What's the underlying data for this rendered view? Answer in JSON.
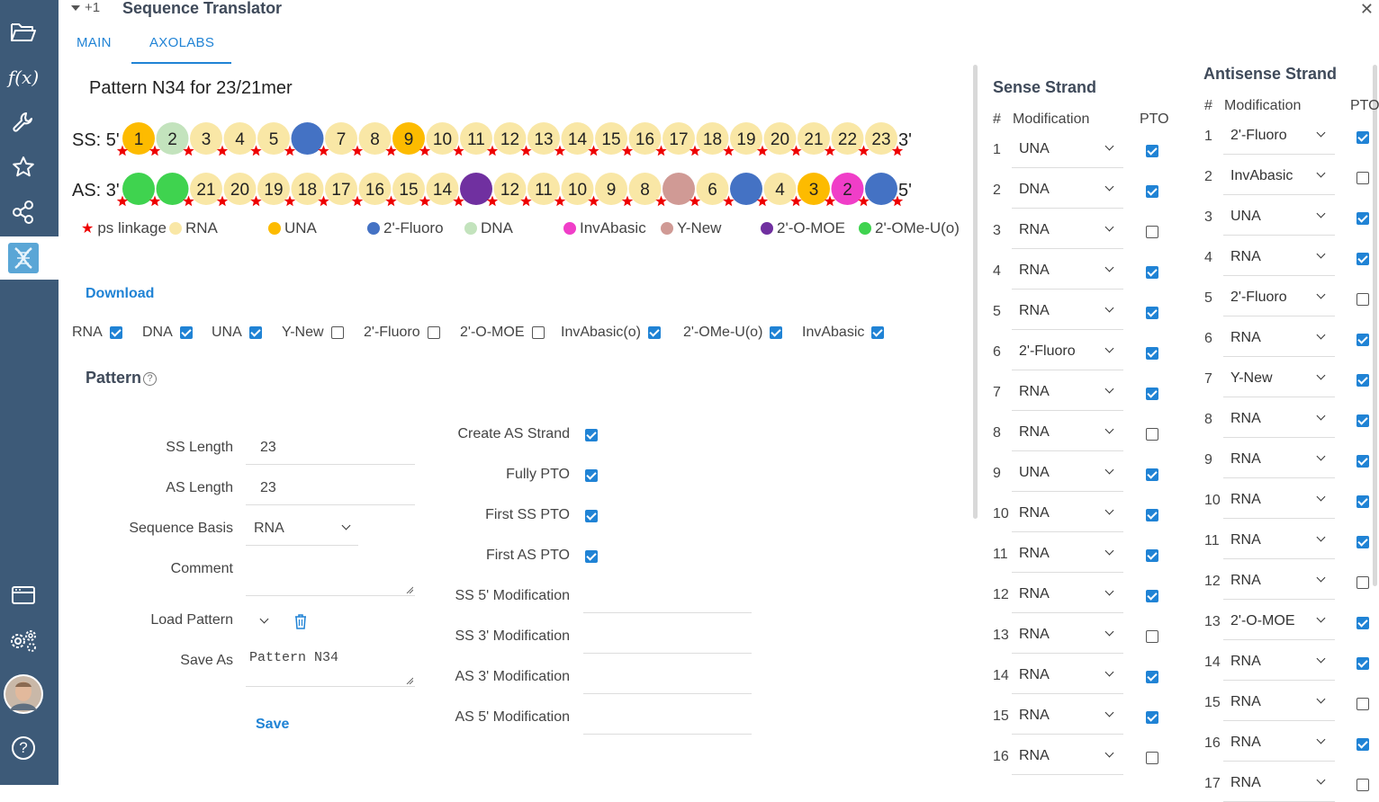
{
  "app": {
    "title": "Sequence Translator",
    "plus_label": "+1",
    "close_glyph": "✕"
  },
  "tabs": [
    {
      "label": "MAIN",
      "active": false
    },
    {
      "label": "AXOLABS",
      "active": true
    }
  ],
  "pattern_title": "Pattern N34 for 23/21mer",
  "pattern_view": {
    "ss_label": "SS: 5'",
    "ss_end": "3'",
    "as_label": "AS: 3'",
    "as_end": "5'",
    "ss": [
      {
        "t": "1",
        "c": "#fdbb00"
      },
      {
        "t": "2",
        "c": "#c3e3bd"
      },
      {
        "t": "3",
        "c": "#f9e7a6"
      },
      {
        "t": "4",
        "c": "#f9e7a6"
      },
      {
        "t": "5",
        "c": "#f9e7a6"
      },
      {
        "t": "",
        "c": "#4472c4"
      },
      {
        "t": "7",
        "c": "#f9e7a6"
      },
      {
        "t": "8",
        "c": "#f9e7a6"
      },
      {
        "t": "9",
        "c": "#fdbb00"
      },
      {
        "t": "10",
        "c": "#f9e7a6"
      },
      {
        "t": "11",
        "c": "#f9e7a6"
      },
      {
        "t": "12",
        "c": "#f9e7a6"
      },
      {
        "t": "13",
        "c": "#f9e7a6"
      },
      {
        "t": "14",
        "c": "#f9e7a6"
      },
      {
        "t": "15",
        "c": "#f9e7a6"
      },
      {
        "t": "16",
        "c": "#f9e7a6"
      },
      {
        "t": "17",
        "c": "#f9e7a6"
      },
      {
        "t": "18",
        "c": "#f9e7a6"
      },
      {
        "t": "19",
        "c": "#f9e7a6"
      },
      {
        "t": "20",
        "c": "#f9e7a6"
      },
      {
        "t": "21",
        "c": "#f9e7a6"
      },
      {
        "t": "22",
        "c": "#f9e7a6"
      },
      {
        "t": "23",
        "c": "#f9e7a6"
      }
    ],
    "as": [
      {
        "t": "",
        "c": "#3fd34f"
      },
      {
        "t": "",
        "c": "#3fd34f"
      },
      {
        "t": "21",
        "c": "#f9e7a6"
      },
      {
        "t": "20",
        "c": "#f9e7a6"
      },
      {
        "t": "19",
        "c": "#f9e7a6"
      },
      {
        "t": "18",
        "c": "#f9e7a6"
      },
      {
        "t": "17",
        "c": "#f9e7a6"
      },
      {
        "t": "16",
        "c": "#f9e7a6"
      },
      {
        "t": "15",
        "c": "#f9e7a6"
      },
      {
        "t": "14",
        "c": "#f9e7a6"
      },
      {
        "t": "",
        "c": "#7030a0"
      },
      {
        "t": "12",
        "c": "#f9e7a6"
      },
      {
        "t": "11",
        "c": "#f9e7a6"
      },
      {
        "t": "10",
        "c": "#f9e7a6"
      },
      {
        "t": "9",
        "c": "#f9e7a6"
      },
      {
        "t": "8",
        "c": "#f9e7a6"
      },
      {
        "t": "",
        "c": "#d09a95"
      },
      {
        "t": "6",
        "c": "#f9e7a6"
      },
      {
        "t": "",
        "c": "#4472c4"
      },
      {
        "t": "4",
        "c": "#f9e7a6"
      },
      {
        "t": "3",
        "c": "#fdbb00"
      },
      {
        "t": "2",
        "c": "#f03ec8"
      },
      {
        "t": "",
        "c": "#4472c4"
      }
    ]
  },
  "legend": [
    {
      "label": "ps linkage",
      "color": "#e00",
      "kind": "star"
    },
    {
      "label": "RNA",
      "color": "#f9e7a6"
    },
    {
      "label": "UNA",
      "color": "#fdbb00"
    },
    {
      "label": "2'-Fluoro",
      "color": "#4472c4"
    },
    {
      "label": "DNA",
      "color": "#c3e3bd"
    },
    {
      "label": "InvAbasic",
      "color": "#f03ec8"
    },
    {
      "label": "Y-New",
      "color": "#d09a95"
    },
    {
      "label": "2'-O-MOE",
      "color": "#7030a0"
    },
    {
      "label": "2'-OMe-U(o)",
      "color": "#3fd34f"
    }
  ],
  "download_label": "Download",
  "filters": [
    {
      "label": "RNA",
      "checked": true
    },
    {
      "label": "DNA",
      "checked": true
    },
    {
      "label": "UNA",
      "checked": true
    },
    {
      "label": "Y-New",
      "checked": false
    },
    {
      "label": "2'-Fluoro",
      "checked": false
    },
    {
      "label": "2'-O-MOE",
      "checked": false
    },
    {
      "label": "InvAbasic(o)",
      "checked": true
    },
    {
      "label": "2'-OMe-U(o)",
      "checked": true
    },
    {
      "label": "InvAbasic",
      "checked": true
    }
  ],
  "pattern_section": {
    "title": "Pattern",
    "help": "?",
    "ss_length_label": "SS Length",
    "ss_length": "23",
    "as_length_label": "AS Length",
    "as_length": "23",
    "basis_label": "Sequence Basis",
    "basis": "RNA",
    "comment_label": "Comment",
    "comment": "",
    "load_label": "Load Pattern",
    "save_as_label": "Save As",
    "save_as": "Pattern N34",
    "save_label": "Save",
    "create_as_label": "Create AS Strand",
    "create_as": true,
    "fully_pto_label": "Fully PTO",
    "fully_pto": true,
    "first_ss_pto_label": "First SS PTO",
    "first_ss_pto": true,
    "first_as_pto_label": "First AS PTO",
    "first_as_pto": true,
    "ss5_label": "SS 5' Modification",
    "ss5": "",
    "ss3_label": "SS 3' Modification",
    "ss3": "",
    "as3_label": "AS 3' Modification",
    "as3": "",
    "as5_label": "AS 5' Modification",
    "as5": ""
  },
  "sense": {
    "title": "Sense Strand",
    "col_num": "#",
    "col_mod": "Modification",
    "col_pto": "PTO",
    "rows": [
      {
        "n": "1",
        "m": "UNA",
        "p": true
      },
      {
        "n": "2",
        "m": "DNA",
        "p": true
      },
      {
        "n": "3",
        "m": "RNA",
        "p": false
      },
      {
        "n": "4",
        "m": "RNA",
        "p": true
      },
      {
        "n": "5",
        "m": "RNA",
        "p": true
      },
      {
        "n": "6",
        "m": "2'-Fluoro",
        "p": true
      },
      {
        "n": "7",
        "m": "RNA",
        "p": true
      },
      {
        "n": "8",
        "m": "RNA",
        "p": false
      },
      {
        "n": "9",
        "m": "UNA",
        "p": true
      },
      {
        "n": "10",
        "m": "RNA",
        "p": true
      },
      {
        "n": "11",
        "m": "RNA",
        "p": true
      },
      {
        "n": "12",
        "m": "RNA",
        "p": true
      },
      {
        "n": "13",
        "m": "RNA",
        "p": false
      },
      {
        "n": "14",
        "m": "RNA",
        "p": true
      },
      {
        "n": "15",
        "m": "RNA",
        "p": true
      },
      {
        "n": "16",
        "m": "RNA",
        "p": false
      }
    ]
  },
  "antisense": {
    "title": "Antisense Strand",
    "col_num": "#",
    "col_mod": "Modification",
    "col_pto": "PTO",
    "rows": [
      {
        "n": "1",
        "m": "2'-Fluoro",
        "p": true
      },
      {
        "n": "2",
        "m": "InvAbasic",
        "p": false
      },
      {
        "n": "3",
        "m": "UNA",
        "p": true
      },
      {
        "n": "4",
        "m": "RNA",
        "p": true
      },
      {
        "n": "5",
        "m": "2'-Fluoro",
        "p": false
      },
      {
        "n": "6",
        "m": "RNA",
        "p": true
      },
      {
        "n": "7",
        "m": "Y-New",
        "p": true
      },
      {
        "n": "8",
        "m": "RNA",
        "p": true
      },
      {
        "n": "9",
        "m": "RNA",
        "p": true
      },
      {
        "n": "10",
        "m": "RNA",
        "p": true
      },
      {
        "n": "11",
        "m": "RNA",
        "p": true
      },
      {
        "n": "12",
        "m": "RNA",
        "p": false
      },
      {
        "n": "13",
        "m": "2'-O-MOE",
        "p": true
      },
      {
        "n": "14",
        "m": "RNA",
        "p": true
      },
      {
        "n": "15",
        "m": "RNA",
        "p": false
      },
      {
        "n": "16",
        "m": "RNA",
        "p": true
      },
      {
        "n": "17",
        "m": "RNA",
        "p": false
      }
    ]
  },
  "sidebar": {
    "icons": [
      "folder-open-icon",
      "function-icon",
      "wrench-icon",
      "star-icon",
      "share-icon",
      "sequence-translator-icon",
      "window-icon",
      "settings-icon",
      "avatar",
      "help-icon"
    ],
    "function_glyph": "f(x)",
    "help_glyph": "?"
  }
}
